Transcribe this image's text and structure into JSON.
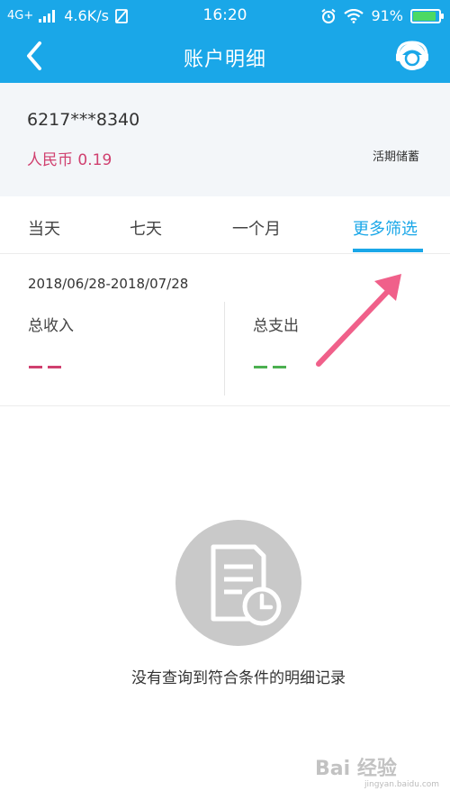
{
  "status_bar": {
    "network": "4G+",
    "speed": "4.6K/s",
    "time": "16:20",
    "battery_percent": "91%",
    "battery_level": 0.91
  },
  "nav": {
    "title": "账户明细",
    "back_icon": "chevron-left-icon",
    "service_icon": "customer-service-icon"
  },
  "account": {
    "number": "6217***8340",
    "balance": "人民币 0.19",
    "type": "活期储蓄"
  },
  "tabs": [
    {
      "label": "当天",
      "active": false
    },
    {
      "label": "七天",
      "active": false
    },
    {
      "label": "一个月",
      "active": false
    },
    {
      "label": "更多筛选",
      "active": true
    }
  ],
  "summary": {
    "date_range": "2018/06/28-2018/07/28",
    "income_label": "总收入",
    "expense_label": "总支出",
    "income_color": "#d0406f",
    "expense_color": "#4cb050"
  },
  "empty_state": {
    "icon": "document-clock-icon",
    "message": "没有查询到符合条件的明细记录"
  },
  "watermark": {
    "text": "Bai 经验",
    "sub": "jingyan.baidu.com"
  },
  "colors": {
    "primary": "#1aa7e8",
    "balance": "#d0406f",
    "annotation_arrow": "#f0608a"
  }
}
